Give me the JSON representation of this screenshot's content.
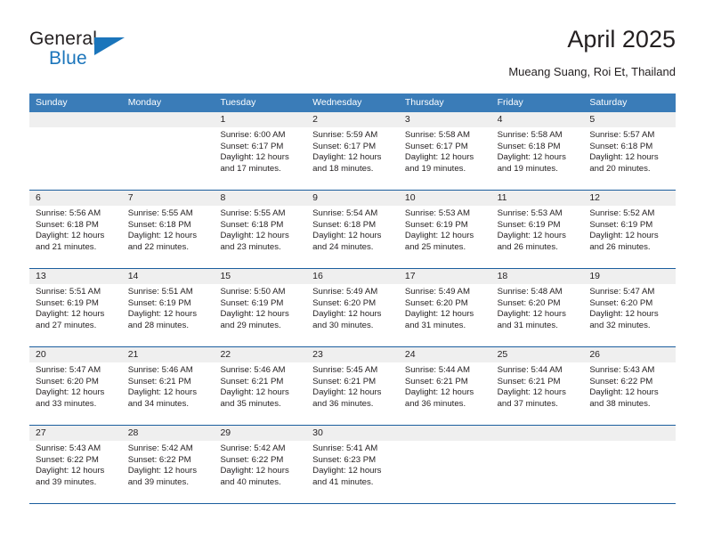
{
  "brand": {
    "name_part1": "General",
    "name_part2": "Blue",
    "flag_icon": "brand-flag-icon"
  },
  "header": {
    "title": "April 2025",
    "subtitle": "Mueang Suang, Roi Et, Thailand"
  },
  "theme": {
    "header_blue": "#3a7cb8",
    "rule_blue": "#1b5e9e",
    "daynum_band": "#efefef",
    "brand_blue": "#1b75bb",
    "text": "#231f20"
  },
  "weekdays": [
    "Sunday",
    "Monday",
    "Tuesday",
    "Wednesday",
    "Thursday",
    "Friday",
    "Saturday"
  ],
  "weeks": [
    [
      {
        "empty": true
      },
      {
        "empty": true
      },
      {
        "day": "1",
        "sunrise": "Sunrise: 6:00 AM",
        "sunset": "Sunset: 6:17 PM",
        "daylight": "Daylight: 12 hours and 17 minutes."
      },
      {
        "day": "2",
        "sunrise": "Sunrise: 5:59 AM",
        "sunset": "Sunset: 6:17 PM",
        "daylight": "Daylight: 12 hours and 18 minutes."
      },
      {
        "day": "3",
        "sunrise": "Sunrise: 5:58 AM",
        "sunset": "Sunset: 6:17 PM",
        "daylight": "Daylight: 12 hours and 19 minutes."
      },
      {
        "day": "4",
        "sunrise": "Sunrise: 5:58 AM",
        "sunset": "Sunset: 6:18 PM",
        "daylight": "Daylight: 12 hours and 19 minutes."
      },
      {
        "day": "5",
        "sunrise": "Sunrise: 5:57 AM",
        "sunset": "Sunset: 6:18 PM",
        "daylight": "Daylight: 12 hours and 20 minutes."
      }
    ],
    [
      {
        "day": "6",
        "sunrise": "Sunrise: 5:56 AM",
        "sunset": "Sunset: 6:18 PM",
        "daylight": "Daylight: 12 hours and 21 minutes."
      },
      {
        "day": "7",
        "sunrise": "Sunrise: 5:55 AM",
        "sunset": "Sunset: 6:18 PM",
        "daylight": "Daylight: 12 hours and 22 minutes."
      },
      {
        "day": "8",
        "sunrise": "Sunrise: 5:55 AM",
        "sunset": "Sunset: 6:18 PM",
        "daylight": "Daylight: 12 hours and 23 minutes."
      },
      {
        "day": "9",
        "sunrise": "Sunrise: 5:54 AM",
        "sunset": "Sunset: 6:18 PM",
        "daylight": "Daylight: 12 hours and 24 minutes."
      },
      {
        "day": "10",
        "sunrise": "Sunrise: 5:53 AM",
        "sunset": "Sunset: 6:19 PM",
        "daylight": "Daylight: 12 hours and 25 minutes."
      },
      {
        "day": "11",
        "sunrise": "Sunrise: 5:53 AM",
        "sunset": "Sunset: 6:19 PM",
        "daylight": "Daylight: 12 hours and 26 minutes."
      },
      {
        "day": "12",
        "sunrise": "Sunrise: 5:52 AM",
        "sunset": "Sunset: 6:19 PM",
        "daylight": "Daylight: 12 hours and 26 minutes."
      }
    ],
    [
      {
        "day": "13",
        "sunrise": "Sunrise: 5:51 AM",
        "sunset": "Sunset: 6:19 PM",
        "daylight": "Daylight: 12 hours and 27 minutes."
      },
      {
        "day": "14",
        "sunrise": "Sunrise: 5:51 AM",
        "sunset": "Sunset: 6:19 PM",
        "daylight": "Daylight: 12 hours and 28 minutes."
      },
      {
        "day": "15",
        "sunrise": "Sunrise: 5:50 AM",
        "sunset": "Sunset: 6:19 PM",
        "daylight": "Daylight: 12 hours and 29 minutes."
      },
      {
        "day": "16",
        "sunrise": "Sunrise: 5:49 AM",
        "sunset": "Sunset: 6:20 PM",
        "daylight": "Daylight: 12 hours and 30 minutes."
      },
      {
        "day": "17",
        "sunrise": "Sunrise: 5:49 AM",
        "sunset": "Sunset: 6:20 PM",
        "daylight": "Daylight: 12 hours and 31 minutes."
      },
      {
        "day": "18",
        "sunrise": "Sunrise: 5:48 AM",
        "sunset": "Sunset: 6:20 PM",
        "daylight": "Daylight: 12 hours and 31 minutes."
      },
      {
        "day": "19",
        "sunrise": "Sunrise: 5:47 AM",
        "sunset": "Sunset: 6:20 PM",
        "daylight": "Daylight: 12 hours and 32 minutes."
      }
    ],
    [
      {
        "day": "20",
        "sunrise": "Sunrise: 5:47 AM",
        "sunset": "Sunset: 6:20 PM",
        "daylight": "Daylight: 12 hours and 33 minutes."
      },
      {
        "day": "21",
        "sunrise": "Sunrise: 5:46 AM",
        "sunset": "Sunset: 6:21 PM",
        "daylight": "Daylight: 12 hours and 34 minutes."
      },
      {
        "day": "22",
        "sunrise": "Sunrise: 5:46 AM",
        "sunset": "Sunset: 6:21 PM",
        "daylight": "Daylight: 12 hours and 35 minutes."
      },
      {
        "day": "23",
        "sunrise": "Sunrise: 5:45 AM",
        "sunset": "Sunset: 6:21 PM",
        "daylight": "Daylight: 12 hours and 36 minutes."
      },
      {
        "day": "24",
        "sunrise": "Sunrise: 5:44 AM",
        "sunset": "Sunset: 6:21 PM",
        "daylight": "Daylight: 12 hours and 36 minutes."
      },
      {
        "day": "25",
        "sunrise": "Sunrise: 5:44 AM",
        "sunset": "Sunset: 6:21 PM",
        "daylight": "Daylight: 12 hours and 37 minutes."
      },
      {
        "day": "26",
        "sunrise": "Sunrise: 5:43 AM",
        "sunset": "Sunset: 6:22 PM",
        "daylight": "Daylight: 12 hours and 38 minutes."
      }
    ],
    [
      {
        "day": "27",
        "sunrise": "Sunrise: 5:43 AM",
        "sunset": "Sunset: 6:22 PM",
        "daylight": "Daylight: 12 hours and 39 minutes."
      },
      {
        "day": "28",
        "sunrise": "Sunrise: 5:42 AM",
        "sunset": "Sunset: 6:22 PM",
        "daylight": "Daylight: 12 hours and 39 minutes."
      },
      {
        "day": "29",
        "sunrise": "Sunrise: 5:42 AM",
        "sunset": "Sunset: 6:22 PM",
        "daylight": "Daylight: 12 hours and 40 minutes."
      },
      {
        "day": "30",
        "sunrise": "Sunrise: 5:41 AM",
        "sunset": "Sunset: 6:23 PM",
        "daylight": "Daylight: 12 hours and 41 minutes."
      },
      {
        "empty": true
      },
      {
        "empty": true
      },
      {
        "empty": true
      }
    ]
  ]
}
